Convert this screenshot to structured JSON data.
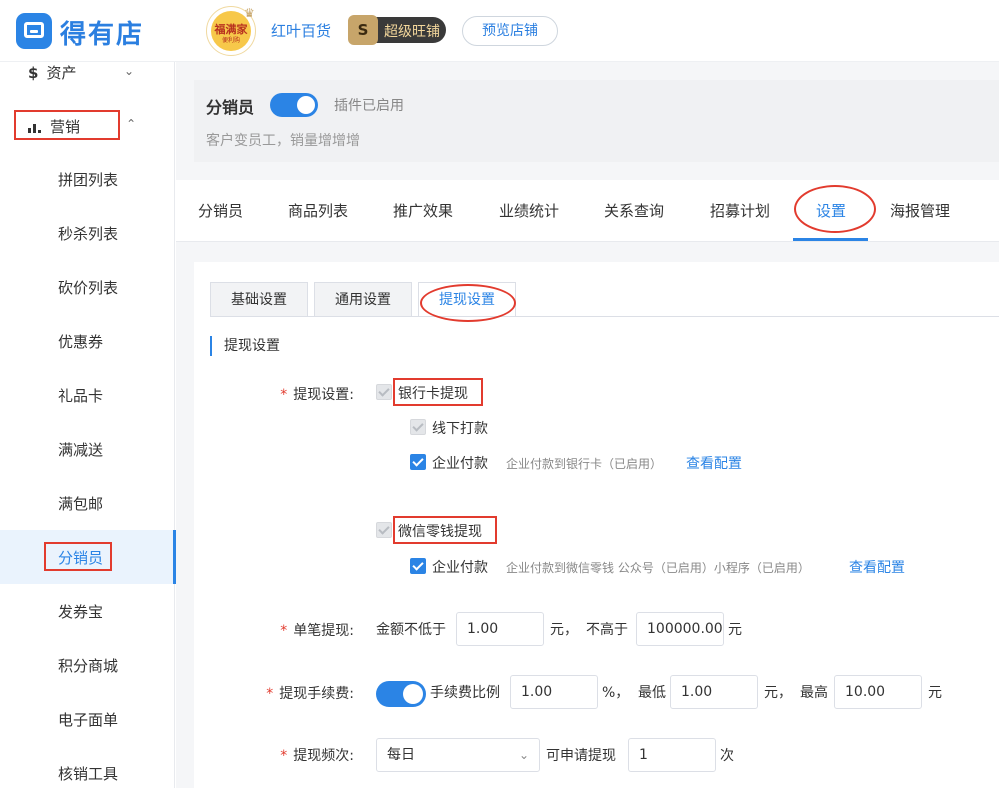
{
  "header": {
    "brand": "得有店",
    "shop_avatar_text": "福满家",
    "shop_avatar_sub": "便利购",
    "shop_name": "红叶百货",
    "vip_label": "超级旺铺",
    "vip_letter": "S",
    "preview_button": "预览店铺"
  },
  "sidebar": {
    "assets_label": "资产",
    "assets_symbol": "$",
    "marketing_label": "营销",
    "items": [
      {
        "label": "拼团列表"
      },
      {
        "label": "秒杀列表"
      },
      {
        "label": "砍价列表"
      },
      {
        "label": "优惠券"
      },
      {
        "label": "礼品卡"
      },
      {
        "label": "满减送"
      },
      {
        "label": "满包邮"
      },
      {
        "label": "分销员",
        "active": true
      },
      {
        "label": "发券宝"
      },
      {
        "label": "积分商城"
      },
      {
        "label": "电子面单"
      },
      {
        "label": "核销工具"
      }
    ]
  },
  "plugin": {
    "title": "分销员",
    "toggle_on": true,
    "status": "插件已启用",
    "description": "客户变员工，销量增增增"
  },
  "tabs": [
    "分销员",
    "商品列表",
    "推广效果",
    "业绩统计",
    "关系查询",
    "招募计划",
    "设置",
    "海报管理"
  ],
  "active_tab": "设置",
  "subtabs": [
    "基础设置",
    "通用设置",
    "提现设置"
  ],
  "active_subtab": "提现设置",
  "section_title": "提现设置",
  "withdraw": {
    "label": "提现设置:",
    "bank_card": "银行卡提现",
    "offline": "线下打款",
    "enterprise_pay": "企业付款",
    "bank_note": "企业付款到银行卡（已启用）",
    "view_config": "查看配置",
    "wechat": "微信零钱提现",
    "wechat_enterprise_pay": "企业付款",
    "wechat_note": "企业付款到微信零钱 公众号（已启用）小程序（已启用）",
    "wechat_view_config": "查看配置"
  },
  "single": {
    "label": "单笔提现:",
    "min_prefix": "金额不低于",
    "min_value": "1.00",
    "unit1": "元，",
    "max_prefix": "不高于",
    "max_value": "100000.00",
    "unit2": "元"
  },
  "fee": {
    "label": "提现手续费:",
    "toggle_on": true,
    "ratio_label": "手续费比例",
    "ratio_value": "1.00",
    "percent": "%，",
    "min_label": "最低",
    "min_value": "1.00",
    "unit1": "元，",
    "max_label": "最高",
    "max_value": "10.00",
    "unit2": "元"
  },
  "frequency": {
    "label": "提现频次:",
    "period": "每日",
    "can_apply": "可申请提现",
    "count": "1",
    "unit": "次"
  },
  "colors": {
    "accent": "#2b84e5",
    "annotation_red": "#e23b2e"
  }
}
